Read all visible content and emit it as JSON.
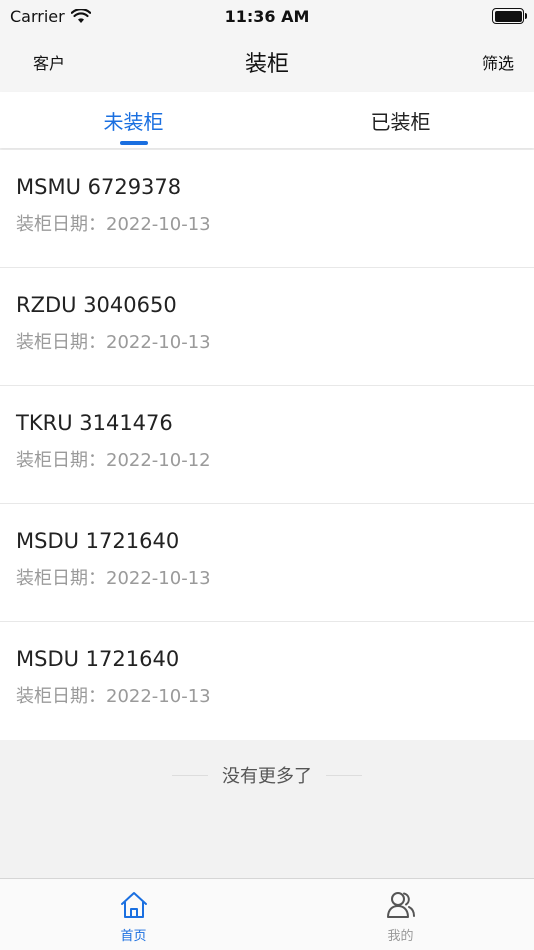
{
  "status_bar": {
    "carrier": "Carrier",
    "time": "11:36 AM"
  },
  "nav": {
    "left": "客户",
    "title": "装柜",
    "right": "筛选"
  },
  "tabs": [
    {
      "label": "未装柜",
      "active": true
    },
    {
      "label": "已装柜",
      "active": false
    }
  ],
  "containers": [
    {
      "number": "MSMU 6729378",
      "date": "装柜日期：2022-10-13"
    },
    {
      "number": "RZDU 3040650",
      "date": "装柜日期：2022-10-13"
    },
    {
      "number": "TKRU 3141476",
      "date": "装柜日期：2022-10-12"
    },
    {
      "number": "MSDU 1721640",
      "date": "装柜日期：2022-10-13"
    },
    {
      "number": "MSDU 1721640",
      "date": "装柜日期：2022-10-13"
    }
  ],
  "no_more": "没有更多了",
  "tab_bar": [
    {
      "label": "首页",
      "icon": "home-icon",
      "active": true
    },
    {
      "label": "我的",
      "icon": "users-icon",
      "active": false
    }
  ],
  "colors": {
    "accent": "#1a6fe0",
    "muted": "#9a9a9a"
  }
}
